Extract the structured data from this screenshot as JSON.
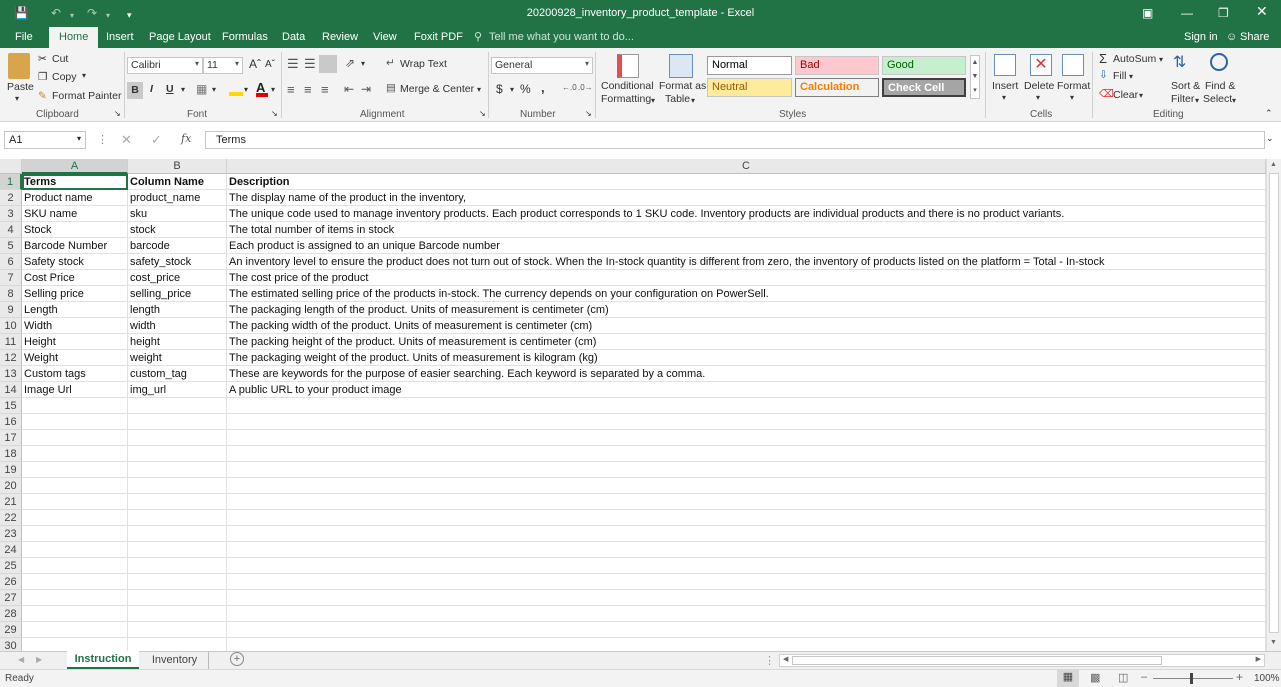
{
  "window": {
    "title": "20200928_inventory_product_template - Excel"
  },
  "tabs": [
    "File",
    "Home",
    "Insert",
    "Page Layout",
    "Formulas",
    "Data",
    "Review",
    "View",
    "Foxit PDF"
  ],
  "active_tab": "Home",
  "tell_me": "Tell me what you want to do...",
  "account": {
    "signin": "Sign in",
    "share": "Share"
  },
  "ribbon": {
    "clipboard": {
      "label": "Clipboard",
      "paste": "Paste",
      "cut": "Cut",
      "copy": "Copy",
      "format_painter": "Format Painter"
    },
    "font": {
      "label": "Font",
      "name": "Calibri",
      "size": "11",
      "bold": "B",
      "italic": "I",
      "underline": "U"
    },
    "alignment": {
      "label": "Alignment",
      "wrap": "Wrap Text",
      "merge": "Merge & Center"
    },
    "number": {
      "label": "Number",
      "format": "General",
      "currency": "$",
      "percent": "%",
      "comma": ","
    },
    "styles": {
      "label": "Styles",
      "cond_fmt_1": "Conditional",
      "cond_fmt_2": "Formatting",
      "fmt_table_1": "Format as",
      "fmt_table_2": "Table",
      "normal": "Normal",
      "bad": "Bad",
      "good": "Good",
      "neutral": "Neutral",
      "calculation": "Calculation",
      "check_cell": "Check Cell"
    },
    "cells": {
      "label": "Cells",
      "insert": "Insert",
      "delete": "Delete",
      "format": "Format"
    },
    "editing": {
      "label": "Editing",
      "autosum": "AutoSum",
      "fill": "Fill",
      "clear": "Clear",
      "sort_1": "Sort &",
      "sort_2": "Filter",
      "find_1": "Find &",
      "find_2": "Select"
    }
  },
  "formula_bar": {
    "name_box": "A1",
    "fx": "fx",
    "value": "Terms"
  },
  "columns": [
    "A",
    "B",
    "C"
  ],
  "rows": [
    [
      "Terms",
      "Column Name",
      "Description"
    ],
    [
      "Product name",
      "product_name",
      "The display name of the product in the inventory,"
    ],
    [
      "SKU name",
      "sku",
      "The unique code used to manage inventory products. Each product corresponds to 1 SKU code. Inventory products are individual products and there is no product variants."
    ],
    [
      "Stock",
      "stock",
      "The total number of items in stock"
    ],
    [
      "Barcode Number",
      "barcode",
      "Each product is assigned to an unique Barcode number"
    ],
    [
      "Safety stock",
      "safety_stock",
      "An inventory level to ensure the product does not turn out of stock. When the In-stock quantity is different from zero, the inventory of products listed on the platform = Total - In-stock"
    ],
    [
      "Cost Price",
      "cost_price",
      "The cost price of the product"
    ],
    [
      "Selling price",
      "selling_price",
      "The estimated selling price of the products in-stock. The currency depends on your configuration on PowerSell."
    ],
    [
      "Length",
      "length",
      "The packaging length of the product. Units of measurement is centimeter (cm)"
    ],
    [
      "Width",
      "width",
      "The packing width of the product. Units of measurement is centimeter (cm)"
    ],
    [
      "Height",
      "height",
      "The packing height of the product. Units of measurement is centimeter (cm)"
    ],
    [
      "Weight",
      "weight",
      "The packaging weight of the product. Units of measurement is kilogram (kg)"
    ],
    [
      "Custom tags",
      "custom_tag",
      "These are keywords for the purpose of easier searching. Each keyword is separated by a comma."
    ],
    [
      "Image Url",
      "img_url",
      "A public URL to your product image"
    ]
  ],
  "row_numbers": [
    "1",
    "2",
    "3",
    "4",
    "5",
    "6",
    "7",
    "8",
    "9",
    "10",
    "11",
    "12",
    "13",
    "14",
    "15",
    "16",
    "17",
    "18",
    "19",
    "20",
    "21",
    "22",
    "23",
    "24",
    "25",
    "26",
    "27",
    "28",
    "29",
    "30"
  ],
  "sheets": [
    "Instruction",
    "Inventory"
  ],
  "active_sheet": "Instruction",
  "status": {
    "ready": "Ready",
    "zoom": "100%"
  },
  "colors": {
    "accent": "#217346",
    "bad_bg": "#ffc7ce",
    "bad_fg": "#9c0006",
    "good_bg": "#c6efce",
    "good_fg": "#006100",
    "neutral_bg": "#ffeb9c",
    "neutral_fg": "#9c5700",
    "calc_fg": "#fa7d00",
    "check_bg": "#a5a5a5"
  }
}
